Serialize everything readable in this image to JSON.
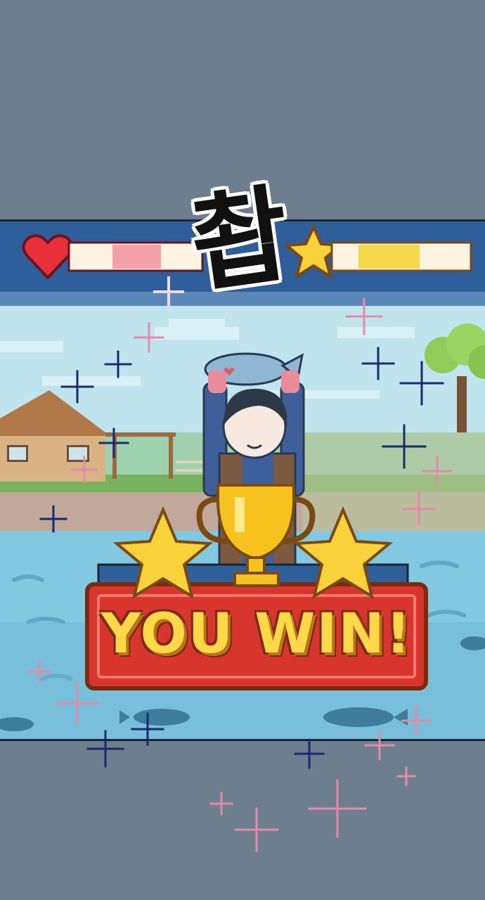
{
  "hud": {
    "health_icon": "heart-icon",
    "health_level": 0.55,
    "score_icon": "star-icon",
    "score_level": 0.55,
    "health_color": "#f4a0a8",
    "score_color": "#f5d84a"
  },
  "sound_effect": "촵",
  "banner": {
    "text": "YOU WIN!",
    "trophy_icon": "trophy-icon",
    "star_icon": "star-icon",
    "color": "#d9352f"
  },
  "scene": {
    "character": "boy-holding-fish",
    "sky_color": "#bfe4ee",
    "water_color": "#82c8e0"
  }
}
